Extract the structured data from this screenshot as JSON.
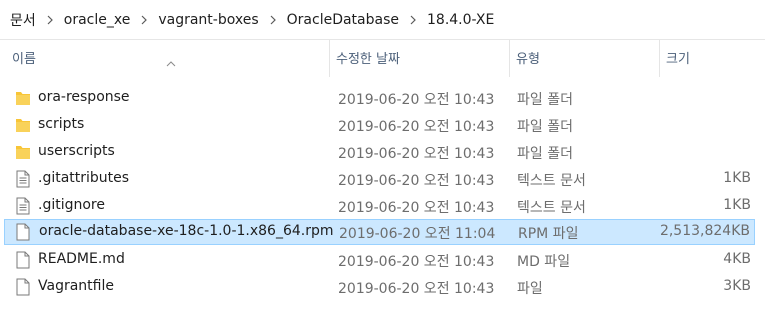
{
  "breadcrumb": {
    "items": [
      "문서",
      "oracle_xe",
      "vagrant-boxes",
      "OracleDatabase",
      "18.4.0-XE"
    ]
  },
  "columns": {
    "name": "이름",
    "date": "수정한 날짜",
    "type": "유형",
    "size": "크기"
  },
  "files": [
    {
      "name": "ora-response",
      "date": "2019-06-20 오전 10:43",
      "type": "파일 폴더",
      "size": "",
      "icon": "folder-icon",
      "selected": false
    },
    {
      "name": "scripts",
      "date": "2019-06-20 오전 10:43",
      "type": "파일 폴더",
      "size": "",
      "icon": "folder-icon",
      "selected": false
    },
    {
      "name": "userscripts",
      "date": "2019-06-20 오전 10:43",
      "type": "파일 폴더",
      "size": "",
      "icon": "folder-icon",
      "selected": false
    },
    {
      "name": ".gitattributes",
      "date": "2019-06-20 오전 10:43",
      "type": "텍스트 문서",
      "size": "1KB",
      "icon": "text-file-icon",
      "selected": false
    },
    {
      "name": ".gitignore",
      "date": "2019-06-20 오전 10:43",
      "type": "텍스트 문서",
      "size": "1KB",
      "icon": "text-file-icon",
      "selected": false
    },
    {
      "name": "oracle-database-xe-18c-1.0-1.x86_64.rpm",
      "date": "2019-06-20 오전 11:04",
      "type": "RPM 파일",
      "size": "2,513,824KB",
      "icon": "blank-file-icon",
      "selected": true
    },
    {
      "name": "README.md",
      "date": "2019-06-20 오전 10:43",
      "type": "MD 파일",
      "size": "4KB",
      "icon": "blank-file-icon",
      "selected": false
    },
    {
      "name": "Vagrantfile",
      "date": "2019-06-20 오전 10:43",
      "type": "파일",
      "size": "3KB",
      "icon": "blank-file-icon",
      "selected": false
    }
  ],
  "colors": {
    "selection_bg": "#cce8ff",
    "selection_border": "#99d1ff",
    "header_text": "#4c607a",
    "folder_yellow": "#f8c537"
  }
}
